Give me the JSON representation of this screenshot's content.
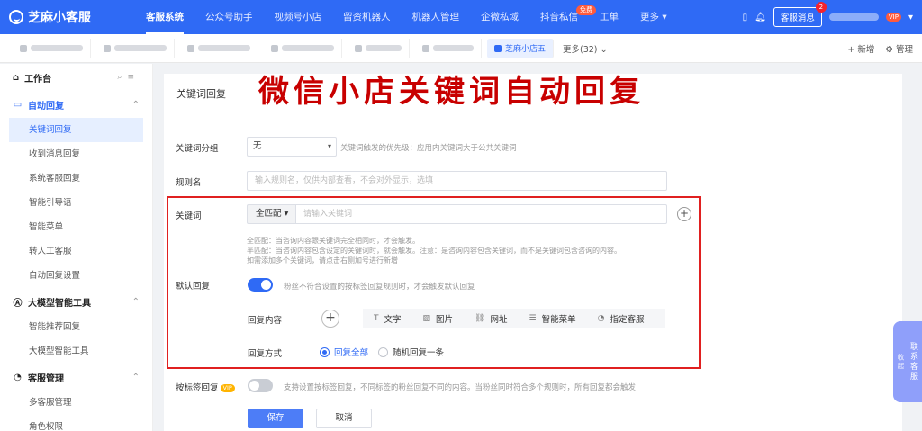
{
  "app": {
    "name": "芝麻小客服"
  },
  "topnav": {
    "items": [
      "客服系统",
      "公众号助手",
      "视频号小店",
      "留资机器人",
      "机器人管理",
      "企微私域",
      "抖音私信",
      "工单",
      "更多"
    ],
    "active_index": 0,
    "free_badge": "免费",
    "kefu_label": "客服消息",
    "kefu_count": "2",
    "vip_label": "VIP"
  },
  "tabs": {
    "active_label": "芝麻小店五",
    "more_label": "更多(32)",
    "add_label": "新增",
    "manage_label": "管理"
  },
  "sidebar": {
    "workbench": "工作台",
    "group_auto_reply": "自动回复",
    "auto_reply_items": [
      "关键词回复",
      "收到消息回复",
      "系统客服回复",
      "智能引导语",
      "智能菜单",
      "转人工客服",
      "自动回复设置"
    ],
    "active_item": "关键词回复",
    "group_ai_tools": "大模型智能工具",
    "ai_items": [
      "智能推荐回复",
      "大模型智能工具"
    ],
    "group_kefu": "客服管理",
    "kefu_items": [
      "多客服管理",
      "角色权限"
    ]
  },
  "main": {
    "page_title": "关键词回复",
    "overlay_title": "微信小店关键词自动回复",
    "group_label": "关键词分组",
    "group_value": "无",
    "group_hint": "关键词触发的优先级：应用内关键词大于公共关键词",
    "rule_label": "规则名",
    "rule_placeholder": "输入规则名，仅供内部查看，不会对外显示，选填",
    "keyword_label": "关键词",
    "keyword_match": "全匹配",
    "keyword_placeholder": "请输入关键词",
    "note_1": "全匹配：当咨询内容跟关键词完全相同时，才会触发。",
    "note_2": "半匹配：当咨询内容包含设定的关键词时，就会触发。注意：是咨询内容包含关键词，而不是关键词包含咨询的内容。",
    "note_3": "如需添加多个关键词，请点击右侧加号进行新增",
    "default_reply_label": "默认回复",
    "default_reply_hint": "粉丝不符合设置的按标签回复规则时，才会触发默认回复",
    "reply_content_label": "回复内容",
    "content_types": [
      "文字",
      "图片",
      "网址",
      "智能菜单",
      "指定客服"
    ],
    "reply_mode_label": "回复方式",
    "reply_mode_all": "回复全部",
    "reply_mode_random": "随机回复一条",
    "tag_reply_label": "按标签回复",
    "tag_vip": "VIP",
    "tag_reply_hint": "支持设置按标签回复，不同标签的粉丝回复不同的内容。当粉丝同时符合多个规则时，所有回复都会触发",
    "save_label": "保存",
    "cancel_label": "取消"
  },
  "float_contact": {
    "primary": "联系客服",
    "secondary": "收起"
  }
}
